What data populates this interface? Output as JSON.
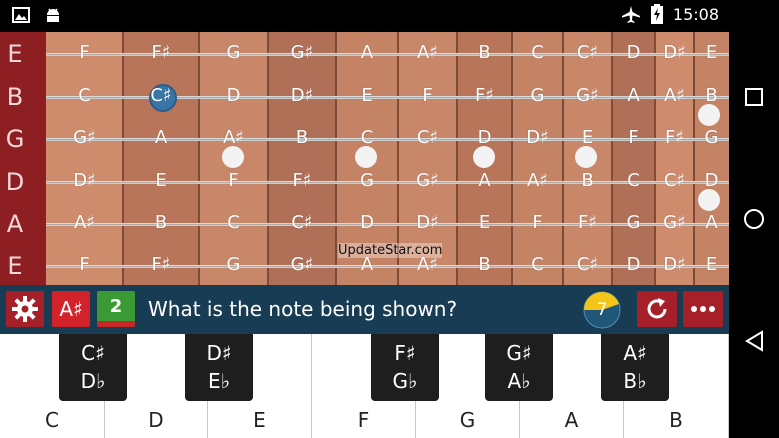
{
  "status_bar": {
    "time": "15:08"
  },
  "strings": [
    "E",
    "B",
    "G",
    "D",
    "A",
    "E"
  ],
  "fret_notes": [
    [
      "F",
      "F♯",
      "G",
      "G♯",
      "A",
      "A♯",
      "B",
      "C",
      "C♯",
      "D",
      "D♯",
      "E"
    ],
    [
      "C",
      "C♯",
      "D",
      "D♯",
      "E",
      "F",
      "F♯",
      "G",
      "G♯",
      "A",
      "A♯",
      "B"
    ],
    [
      "G♯",
      "A",
      "A♯",
      "B",
      "C",
      "C♯",
      "D",
      "D♯",
      "E",
      "F",
      "F♯",
      "G"
    ],
    [
      "D♯",
      "E",
      "F",
      "F♯",
      "G",
      "G♯",
      "A",
      "A♯",
      "B",
      "C",
      "C♯",
      "D"
    ],
    [
      "A♯",
      "B",
      "C",
      "C♯",
      "D",
      "D♯",
      "E",
      "F",
      "F♯",
      "G",
      "G♯",
      "A"
    ],
    [
      "F",
      "F♯",
      "G",
      "G♯",
      "A",
      "A♯",
      "B",
      "C",
      "C♯",
      "D",
      "D♯",
      "E"
    ]
  ],
  "highlighted": {
    "string": 1,
    "fret": 1
  },
  "watermark": "UpdateStar.com",
  "toolbar": {
    "accidental_label": "A♯",
    "level_label": "2",
    "question": "What is the note being shown?",
    "timer_value": "7",
    "colors": {
      "bar": "#173c53",
      "settings": "#a52028",
      "accidental": "#d2232a",
      "level": "#3a9b35",
      "timer": "#f5c518"
    }
  },
  "piano": {
    "white_keys": [
      "C",
      "D",
      "E",
      "F",
      "G",
      "A",
      "B"
    ],
    "black_keys": [
      {
        "sharp": "C♯",
        "flat": "D♭"
      },
      {
        "sharp": "D♯",
        "flat": "E♭"
      },
      {
        "sharp": "F♯",
        "flat": "G♭"
      },
      {
        "sharp": "G♯",
        "flat": "A♭"
      },
      {
        "sharp": "A♯",
        "flat": "B♭"
      }
    ]
  }
}
